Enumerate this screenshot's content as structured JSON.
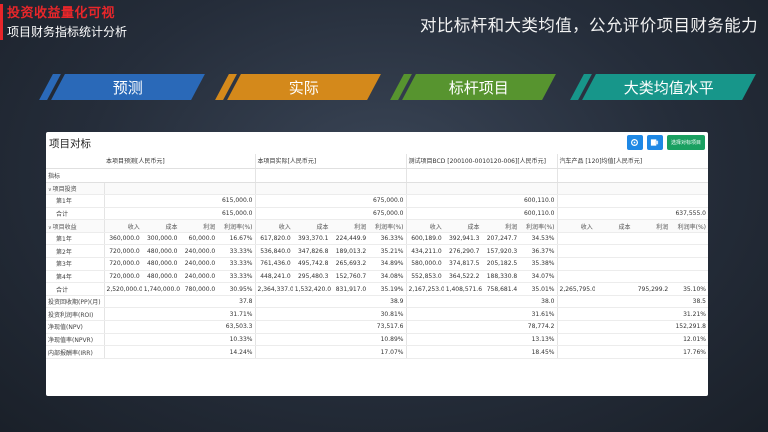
{
  "brand": {
    "title": "投资收益量化可视",
    "subtitle": "项目财务指标统计分析"
  },
  "headline": "对比标杆和大类均值，公允评价项目财务能力",
  "tabs": [
    {
      "label": "预测",
      "color": "#2a69b8"
    },
    {
      "label": "实际",
      "color": "#d4891b"
    },
    {
      "label": "标杆项目",
      "color": "#57942f"
    },
    {
      "label": "大类均值水平",
      "color": "#17968a"
    }
  ],
  "panel": {
    "title": "项目对标",
    "select_btn": "选择对标项目",
    "col_header_label": "指标",
    "groups": [
      "本项目预测[人民币元]",
      "本项目实际[人民币元]",
      "测试项目BCD [200100-0010120-006][人民币元]",
      "汽车产品 [120]均值[人民币元]"
    ],
    "sub_headers": [
      "收入",
      "成本",
      "利润",
      "利润率(%)"
    ],
    "rows": [
      {
        "label": "项目投资",
        "type": "group",
        "cells": [
          "",
          "",
          "",
          "",
          "",
          "",
          "",
          "",
          "",
          "",
          "",
          "",
          "",
          "",
          "",
          ""
        ]
      },
      {
        "label": "第1年",
        "type": "sub",
        "cells": [
          "",
          "",
          "",
          "615,000.0",
          "",
          "",
          "",
          "675,000.0",
          "",
          "",
          "",
          "600,110.0",
          "",
          "",
          "",
          ""
        ]
      },
      {
        "label": "合计",
        "type": "sub",
        "cells": [
          "",
          "",
          "",
          "615,000.0",
          "",
          "",
          "",
          "675,000.0",
          "",
          "",
          "",
          "600,110.0",
          "",
          "",
          "",
          "637,555.0"
        ]
      },
      {
        "label": "项目收益",
        "type": "group-head",
        "cells": [
          "收入",
          "成本",
          "利润",
          "利润率(%)",
          "收入",
          "成本",
          "利润",
          "利润率(%)",
          "收入",
          "成本",
          "利润",
          "利润率(%)",
          "收入",
          "成本",
          "利润",
          "利润率(%)"
        ]
      },
      {
        "label": "第1年",
        "type": "sub",
        "cells": [
          "360,000.0",
          "300,000.0",
          "60,000.0",
          "16.67%",
          "617,820.0",
          "393,370.1",
          "224,449.9",
          "36.33%",
          "600,189.0",
          "392,941.3",
          "207,247.7",
          "34.53%",
          "",
          "",
          "",
          ""
        ]
      },
      {
        "label": "第2年",
        "type": "sub",
        "cells": [
          "720,000.0",
          "480,000.0",
          "240,000.0",
          "33.33%",
          "536,840.0",
          "347,826.8",
          "189,013.2",
          "35.21%",
          "434,211.0",
          "276,290.7",
          "157,920.3",
          "36.37%",
          "",
          "",
          "",
          ""
        ]
      },
      {
        "label": "第3年",
        "type": "sub",
        "cells": [
          "720,000.0",
          "480,000.0",
          "240,000.0",
          "33.33%",
          "761,436.0",
          "495,742.8",
          "265,693.2",
          "34.89%",
          "580,000.0",
          "374,817.5",
          "205,182.5",
          "35.38%",
          "",
          "",
          "",
          ""
        ]
      },
      {
        "label": "第4年",
        "type": "sub",
        "cells": [
          "720,000.0",
          "480,000.0",
          "240,000.0",
          "33.33%",
          "448,241.0",
          "295,480.3",
          "152,760.7",
          "34.08%",
          "552,853.0",
          "364,522.2",
          "188,330.8",
          "34.07%",
          "",
          "",
          "",
          ""
        ]
      },
      {
        "label": "合计",
        "type": "sub",
        "cells": [
          "2,520,000.0",
          "1,740,000.0",
          "780,000.0",
          "30.95%",
          "2,364,337.0",
          "1,532,420.0",
          "831,917.0",
          "35.19%",
          "2,167,253.0",
          "1,408,571.6",
          "758,681.4",
          "35.01%",
          "2,265,795.0",
          "",
          "795,299.2",
          "35.10%"
        ]
      },
      {
        "label": "投资回收期(PP)(月)",
        "type": "metric",
        "cells": [
          "",
          "",
          "",
          "37.8",
          "",
          "",
          "",
          "38.9",
          "",
          "",
          "",
          "38.0",
          "",
          "",
          "",
          "38.5"
        ]
      },
      {
        "label": "投资利润率(ROI)",
        "type": "metric",
        "cells": [
          "",
          "",
          "",
          "31.71%",
          "",
          "",
          "",
          "30.81%",
          "",
          "",
          "",
          "31.61%",
          "",
          "",
          "",
          "31.21%"
        ]
      },
      {
        "label": "净现值(NPV)",
        "type": "metric",
        "cells": [
          "",
          "",
          "",
          "63,503.3",
          "",
          "",
          "",
          "73,517.6",
          "",
          "",
          "",
          "78,774.2",
          "",
          "",
          "",
          "152,291.8"
        ]
      },
      {
        "label": "净现值率(NPVR)",
        "type": "metric",
        "cells": [
          "",
          "",
          "",
          "10.33%",
          "",
          "",
          "",
          "10.89%",
          "",
          "",
          "",
          "13.13%",
          "",
          "",
          "",
          "12.01%"
        ]
      },
      {
        "label": "内部报酬率(IRR)",
        "type": "metric",
        "cells": [
          "",
          "",
          "",
          "14.24%",
          "",
          "",
          "",
          "17.07%",
          "",
          "",
          "",
          "18.45%",
          "",
          "",
          "",
          "17.76%"
        ]
      }
    ]
  },
  "icons": {
    "settings": "gear-icon",
    "export": "export-icon"
  }
}
